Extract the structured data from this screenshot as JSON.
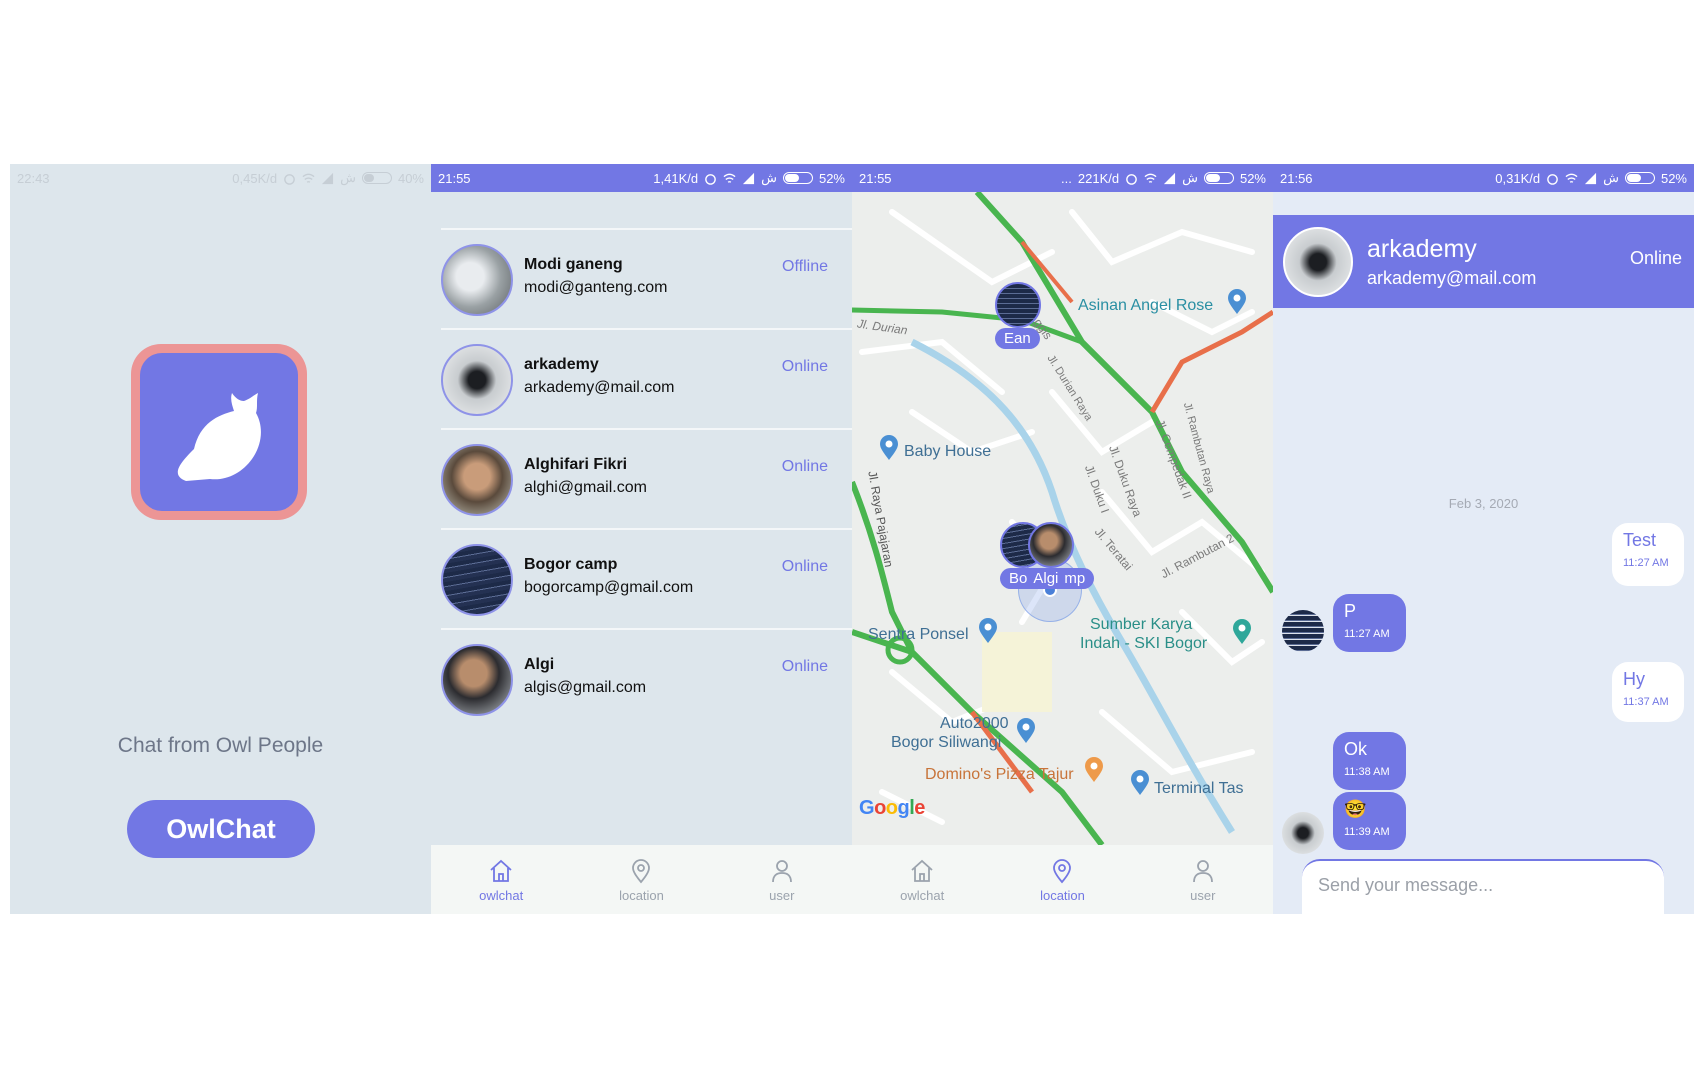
{
  "splash": {
    "status": {
      "time": "22:43",
      "speed": "0,45K/d",
      "carrier": "ش",
      "battery": "40%"
    },
    "tagline": "Chat from Owl People",
    "cta_label": "OwlChat",
    "colors": {
      "accent": "#7277e4",
      "logo_border": "#ec9595",
      "background": "#dde6ec"
    }
  },
  "contacts": {
    "status": {
      "time": "21:55",
      "speed": "1,41K/d",
      "carrier": "ش",
      "battery": "52%"
    },
    "items": [
      {
        "name": "Modi ganeng",
        "email": "modi@ganteng.com",
        "status": "Offline"
      },
      {
        "name": "arkademy",
        "email": "arkademy@mail.com",
        "status": "Online"
      },
      {
        "name": "Alghifari Fikri",
        "email": "alghi@gmail.com",
        "status": "Online"
      },
      {
        "name": "Bogor camp",
        "email": "bogorcamp@gmail.com",
        "status": "Online"
      },
      {
        "name": "Algi",
        "email": "algis@gmail.com",
        "status": "Online"
      }
    ]
  },
  "location": {
    "status": {
      "time": "21:55",
      "dots": "...",
      "speed": "221K/d",
      "carrier": "ش",
      "battery": "52%"
    },
    "places": {
      "asinan": "Asinan Angel Rose",
      "baby_house": "Baby House",
      "sentra": "Sentra Ponsel",
      "sumber_1": "Sumber Karya",
      "sumber_2": "Indah - SKI Bogor",
      "auto_1": "Auto2000",
      "auto_2": "Bogor Siliwangi",
      "dominos": "Domino's Pizza Tajur",
      "terminal": "Terminal Tas"
    },
    "streets": {
      "durian": "Jl. Durian",
      "durian_raya": "Jl. Durian Raya",
      "duku_raya": "Jl. Duku Raya",
      "duku_1": "Jl. Duku I",
      "cempedak": "Jl. Cempedak II",
      "rambutan_raya": "Jl. Rambutan Raya",
      "teratai": "Jl. Teratai",
      "rambutan_2": "Jl. Rambutan 2",
      "pajajaran": "Jl. Raya Pajajaran",
      "ggis": "ggis"
    },
    "markers": {
      "ean": "Ean",
      "bog": "Bo",
      "algi": "Algi",
      "mp": "mp"
    },
    "google": "Google"
  },
  "tabs": [
    {
      "label": "owlchat",
      "icon": "home-icon"
    },
    {
      "label": "location",
      "icon": "map-pin-icon"
    },
    {
      "label": "user",
      "icon": "user-icon"
    }
  ],
  "chat": {
    "status": {
      "time": "21:56",
      "speed": "0,31K/d",
      "carrier": "ش",
      "battery": "52%"
    },
    "header": {
      "name": "arkademy",
      "email": "arkademy@mail.com",
      "status": "Online"
    },
    "date": "Feb 3, 2020",
    "messages": [
      {
        "text": "Test",
        "time": "11:27 AM",
        "direction": "out"
      },
      {
        "text": "P",
        "time": "11:27 AM",
        "direction": "in"
      },
      {
        "text": "Hy",
        "time": "11:37 AM",
        "direction": "out"
      },
      {
        "text": "Ok",
        "time": "11:38 AM",
        "direction": "in"
      },
      {
        "text": "🤓",
        "time": "11:39 AM",
        "direction": "in"
      }
    ],
    "composer_placeholder": "Send your message..."
  }
}
